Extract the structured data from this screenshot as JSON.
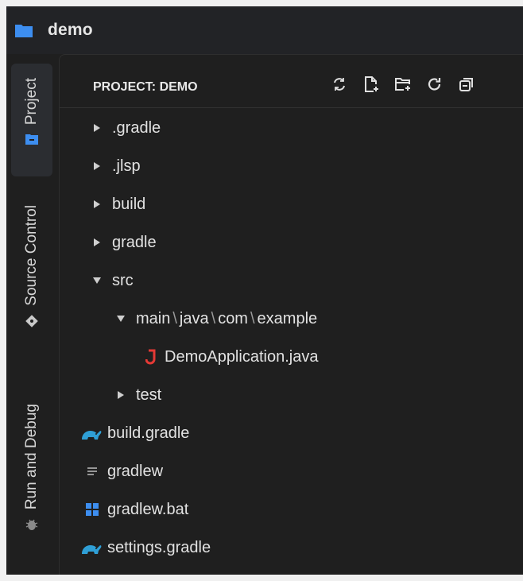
{
  "window": {
    "title": "demo"
  },
  "activity_bar": {
    "tabs": [
      {
        "label": "Project",
        "icon": "folder-icon",
        "active": true
      },
      {
        "label": "Source Control",
        "icon": "git-icon",
        "active": false
      },
      {
        "label": "Run and Debug",
        "icon": "bug-icon",
        "active": false
      }
    ]
  },
  "explorer": {
    "header": "PROJECT: DEMO",
    "actions": [
      "refresh-icon",
      "new-file-icon",
      "new-folder-icon",
      "reload-icon",
      "collapse-all-icon"
    ],
    "items": [
      {
        "label": ".gradle",
        "type": "folder",
        "expanded": false
      },
      {
        "label": ".jlsp",
        "type": "folder",
        "expanded": false
      },
      {
        "label": "build",
        "type": "folder",
        "expanded": false
      },
      {
        "label": "gradle",
        "type": "folder",
        "expanded": false
      },
      {
        "label": "src",
        "type": "folder",
        "expanded": true
      },
      {
        "label_parts": [
          "main",
          "java",
          "com",
          "example"
        ],
        "separator": "\\",
        "type": "folder",
        "expanded": true
      },
      {
        "label": "DemoApplication.java",
        "type": "java-file"
      },
      {
        "label": "test",
        "type": "folder",
        "expanded": false
      },
      {
        "label": "build.gradle",
        "type": "gradle-file"
      },
      {
        "label": "gradlew",
        "type": "text-file"
      },
      {
        "label": "gradlew.bat",
        "type": "windows-file"
      },
      {
        "label": "settings.gradle",
        "type": "gradle-file"
      }
    ]
  },
  "colors": {
    "background": "#1f1f1f",
    "folder_accent": "#3d8ef0",
    "java": "#e53935",
    "gradle": "#2f9fd6"
  }
}
